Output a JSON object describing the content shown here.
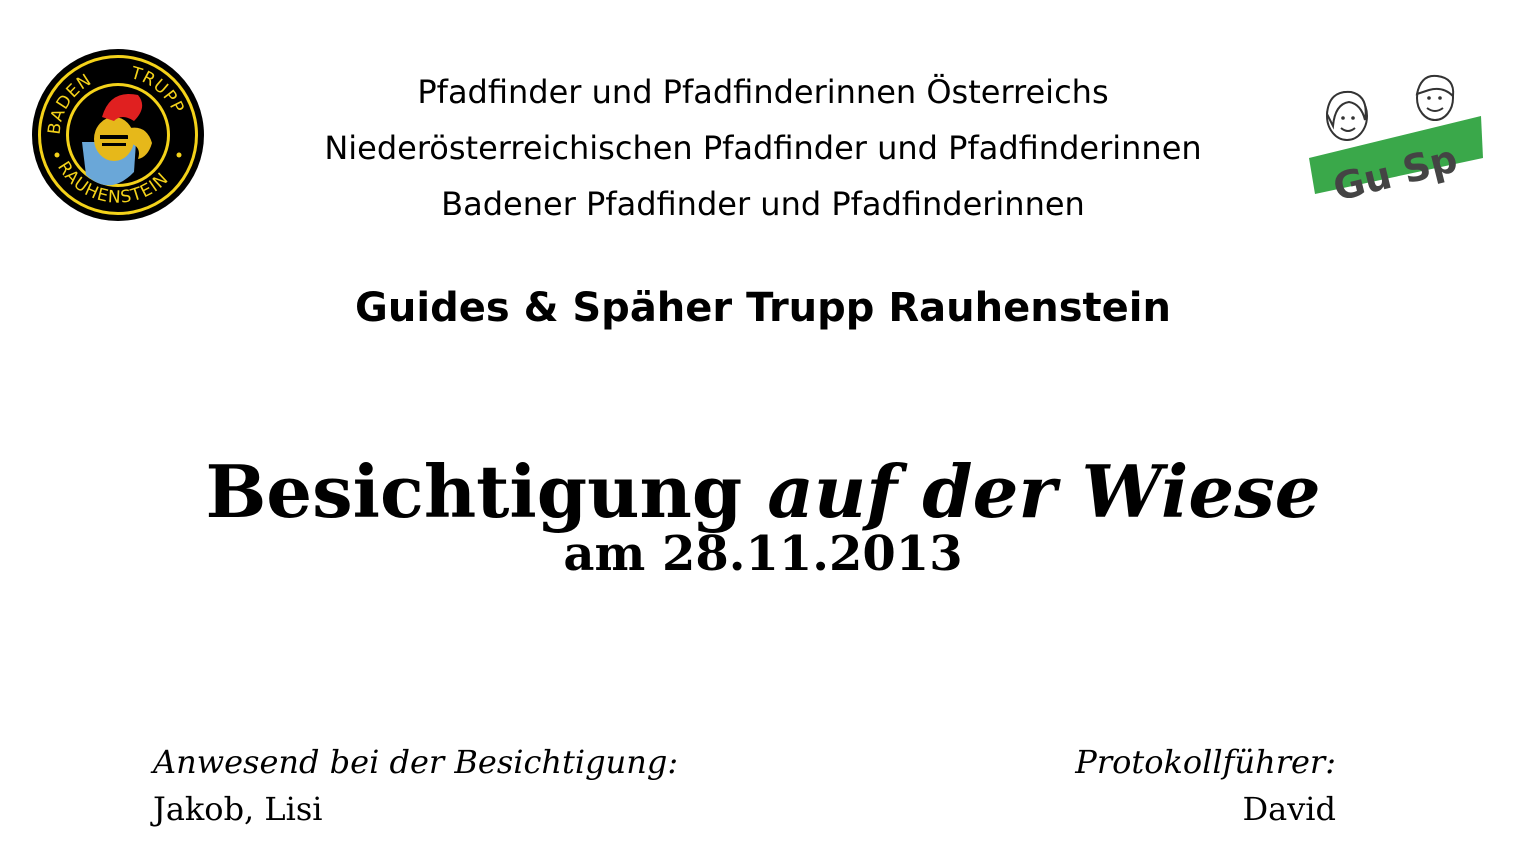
{
  "header": {
    "org_lines": [
      "Pfadfinder und Pfadfinderinnen Österreichs",
      "Niederösterreichischen Pfadfinder und Pfadfinderinnen",
      "Badener Pfadfinder und Pfadfinderinnen"
    ],
    "troop_name": "Guides & Späher Trupp Rauhenstein",
    "left_logo": {
      "icon": "troop-emblem-icon",
      "text_top_left": "BADEN",
      "text_top_right": "TRUPP",
      "text_bottom": "RAUHENSTEIN"
    },
    "right_logo": {
      "icon": "gusp-logo-icon",
      "text": "Gu Sp",
      "accent_color": "#3aa84a"
    }
  },
  "title": {
    "main_regular": "Besichtigung",
    "main_italic": "auf der Wiese",
    "date_line": "am 28.11.2013"
  },
  "footer": {
    "attendees_label": "Anwesend bei der Besichtigung:",
    "attendees_value": "Jakob, Lisi",
    "recorder_label": "Protokollführer:",
    "recorder_value": "David"
  }
}
